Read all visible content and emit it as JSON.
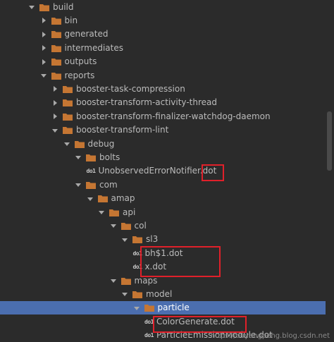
{
  "tree": {
    "rows": [
      {
        "label": "build",
        "level": 0,
        "kind": "folder",
        "expanded": true
      },
      {
        "label": "bin",
        "level": 1,
        "kind": "folder",
        "expanded": false
      },
      {
        "label": "generated",
        "level": 1,
        "kind": "folder",
        "expanded": false
      },
      {
        "label": "intermediates",
        "level": 1,
        "kind": "folder",
        "expanded": false
      },
      {
        "label": "outputs",
        "level": 1,
        "kind": "folder",
        "expanded": false
      },
      {
        "label": "reports",
        "level": 1,
        "kind": "folder",
        "expanded": true
      },
      {
        "label": "booster-task-compression",
        "level": 2,
        "kind": "folder",
        "expanded": false
      },
      {
        "label": "booster-transform-activity-thread",
        "level": 2,
        "kind": "folder",
        "expanded": false
      },
      {
        "label": "booster-transform-finalizer-watchdog-daemon",
        "level": 2,
        "kind": "folder",
        "expanded": false
      },
      {
        "label": "booster-transform-lint",
        "level": 2,
        "kind": "folder",
        "expanded": true
      },
      {
        "label": "debug",
        "level": 3,
        "kind": "folder",
        "expanded": true
      },
      {
        "label": "bolts",
        "level": 4,
        "kind": "folder",
        "expanded": true
      },
      {
        "label": "UnobservedErrorNotifier.dot",
        "level": 5,
        "kind": "file"
      },
      {
        "label": "com",
        "level": 4,
        "kind": "folder",
        "expanded": true
      },
      {
        "label": "amap",
        "level": 5,
        "kind": "folder",
        "expanded": true
      },
      {
        "label": "api",
        "level": 6,
        "kind": "folder",
        "expanded": true
      },
      {
        "label": "col",
        "level": 7,
        "kind": "folder",
        "expanded": true
      },
      {
        "label": "sl3",
        "level": 8,
        "kind": "folder",
        "expanded": true
      },
      {
        "label": "bh$1.dot",
        "level": 9,
        "kind": "file"
      },
      {
        "label": "x.dot",
        "level": 9,
        "kind": "file"
      },
      {
        "label": "maps",
        "level": 7,
        "kind": "folder",
        "expanded": true
      },
      {
        "label": "model",
        "level": 8,
        "kind": "folder",
        "expanded": true
      },
      {
        "label": "particle",
        "level": 9,
        "kind": "folder",
        "expanded": true,
        "selected": true
      },
      {
        "label": "ColorGenerate.dot",
        "level": 10,
        "kind": "file"
      },
      {
        "label": "ParticleEmissionModule.dot",
        "level": 10,
        "kind": "file"
      }
    ]
  },
  "file_icon_text": "do1",
  "watermark": "https://ouyangpeng.blog.csdn.net",
  "colors": {
    "background": "#2b2b2b",
    "folder": "#c57633",
    "selection": "#4b6eaf",
    "highlight_box": "#e0202a",
    "text": "#bbbbbb"
  },
  "icons": {
    "folder": "folder-icon",
    "file": "dot-file-icon",
    "expanded": "chevron-down-icon",
    "collapsed": "chevron-right-icon"
  }
}
